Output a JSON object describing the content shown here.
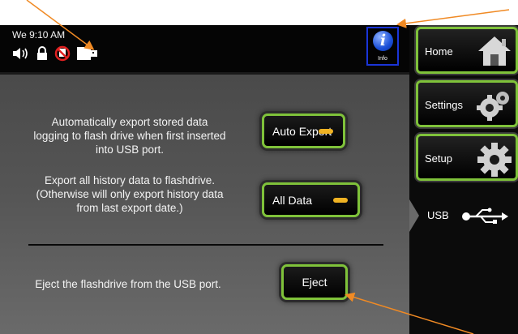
{
  "status_bar": {
    "time": "We 9:10 AM",
    "icons": [
      "speaker-icon",
      "lock-icon",
      "no-network-icon",
      "usb-drive-icon"
    ]
  },
  "info_button": {
    "glyph": "i",
    "label": "Info"
  },
  "main": {
    "auto_export": {
      "description": "Automatically export stored data logging to flash drive when first inserted into USB port.",
      "button_label": "Auto Export"
    },
    "all_data": {
      "description": "Export all history data to flashdrive. (Otherwise will only export history data from last export date.)",
      "button_label": "All Data"
    },
    "eject": {
      "description": "Eject the flashdrive from the USB port.",
      "button_label": "Eject"
    }
  },
  "nav": {
    "home": "Home",
    "settings": "Settings",
    "setup": "Setup",
    "usb": "USB"
  },
  "colors": {
    "accent_green": "#7fc23a",
    "led_amber": "#f0b323",
    "annotation_orange": "#f08a24",
    "info_blue": "#1a35d8"
  }
}
